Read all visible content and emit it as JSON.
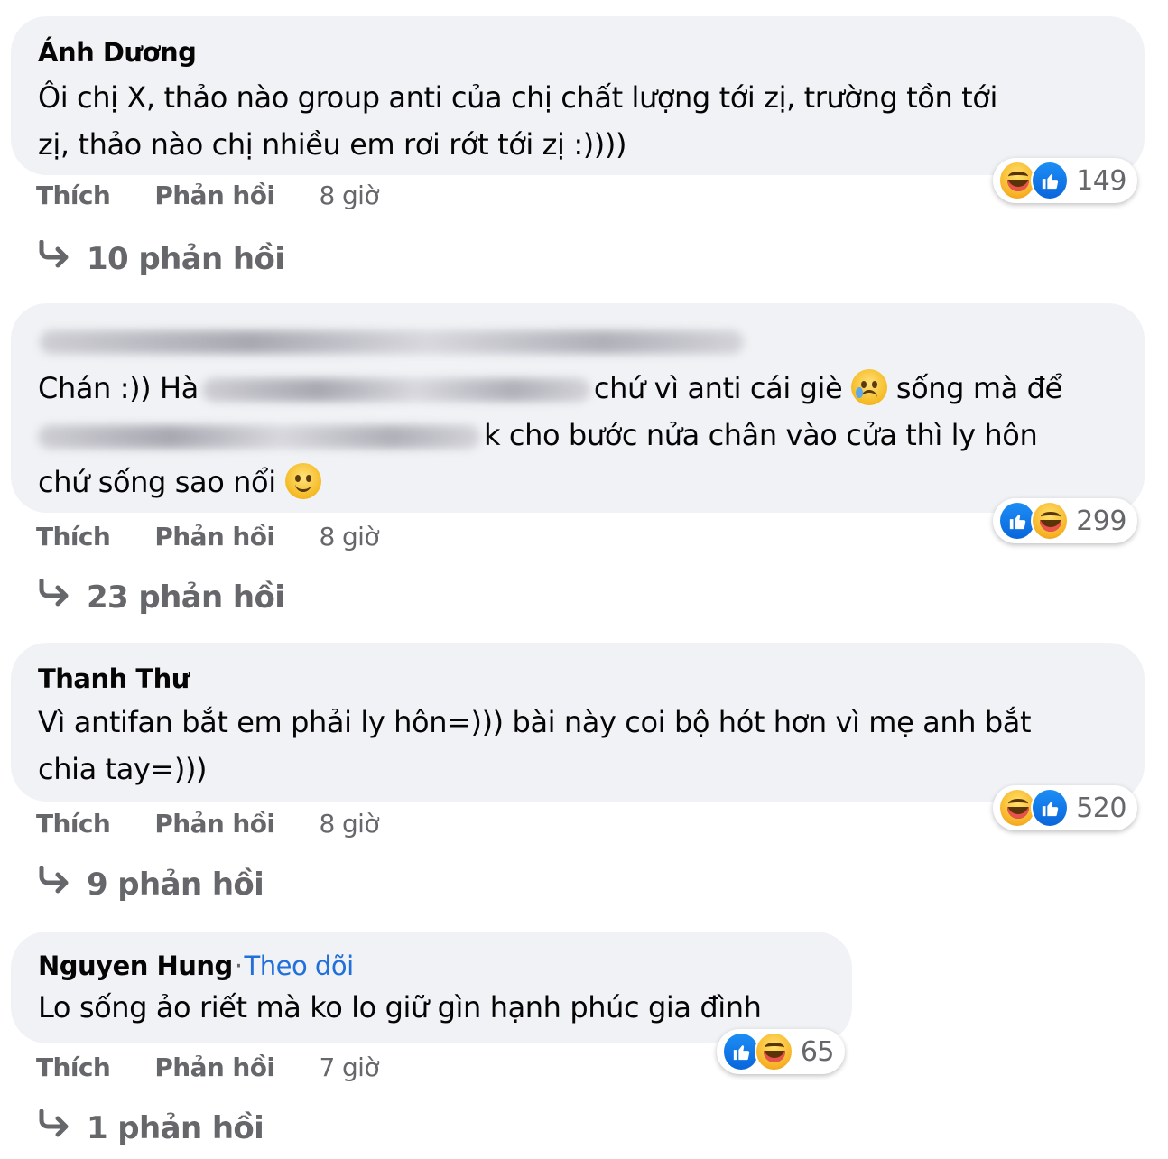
{
  "comments": [
    {
      "author": "Ánh Dương",
      "lines": [
        "Ôi chị X, thảo nào group anti của chị chất lượng tới zị, trường tồn tới",
        "zị, thảo nào chị nhiều em rơi rớt tới zị :))))"
      ],
      "reactions": {
        "icons": [
          "haha",
          "like"
        ],
        "count": "149"
      },
      "like_label": "Thích",
      "reply_label": "Phản hồi",
      "time": "8 giờ",
      "replies_label": "10 phản hồi"
    },
    {
      "author": "",
      "line1_start": "Chán :)) Hà",
      "line1_end": "chứ vì anti cái giè",
      "line1_tail": "sống mà để",
      "line2_end": "k cho bước nửa chân vào cửa thì ly hôn",
      "line3": "chứ sống sao nổi",
      "reactions": {
        "icons": [
          "like",
          "haha"
        ],
        "count": "299"
      },
      "like_label": "Thích",
      "reply_label": "Phản hồi",
      "time": "8 giờ",
      "replies_label": "23 phản hồi"
    },
    {
      "author": "Thanh Thư",
      "lines": [
        "Vì antifan bắt em phải ly hôn=))) bài này coi bộ hót hơn vì mẹ anh bắt",
        "chia tay=)))"
      ],
      "reactions": {
        "icons": [
          "haha",
          "like"
        ],
        "count": "520"
      },
      "like_label": "Thích",
      "reply_label": "Phản hồi",
      "time": "8 giờ",
      "replies_label": "9 phản hồi"
    },
    {
      "author": "Nguyen Hung",
      "follow_label": "Theo dõi",
      "lines": [
        "Lo sống ảo riết mà ko lo giữ gìn hạnh phúc gia đình"
      ],
      "reactions": {
        "icons": [
          "like",
          "haha"
        ],
        "count": "65"
      },
      "like_label": "Thích",
      "reply_label": "Phản hồi",
      "time": "7 giờ",
      "replies_label": "1 phản hồi"
    }
  ],
  "colors": {
    "bubble": "#f0f2f5",
    "meta_text": "#65676b",
    "follow_link": "#216fdb",
    "like_blue": "#1877f2"
  },
  "icons": {
    "reply_arrow": "reply-arrow-icon",
    "like": "like-reaction-icon",
    "haha": "haha-reaction-icon"
  }
}
